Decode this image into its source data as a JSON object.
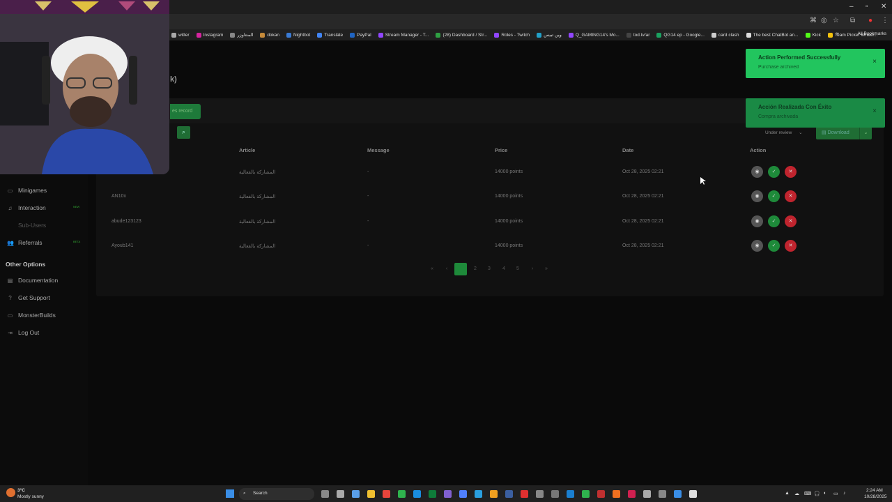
{
  "browser": {
    "bookmarks": [
      {
        "label": "witter",
        "color": "#aaaaaa"
      },
      {
        "label": "Instagram",
        "color": "#d6249f"
      },
      {
        "label": "المنتاوزر",
        "color": "#888888"
      },
      {
        "label": "dokan",
        "color": "#c58a3a"
      },
      {
        "label": "Nightbot",
        "color": "#3a7bd5"
      },
      {
        "label": "Translate",
        "color": "#4285f4"
      },
      {
        "label": "PayPal",
        "color": "#1f64c2"
      },
      {
        "label": "Stream Manager - T...",
        "color": "#9146ff"
      },
      {
        "label": "(28) Dashboard / Str...",
        "color": "#2ea043"
      },
      {
        "label": "Roles - Twitch",
        "color": "#9146ff"
      },
      {
        "label": "وين تبيس",
        "color": "#22a0c8"
      },
      {
        "label": "Q_GAMING14's Mo...",
        "color": "#9146ff"
      },
      {
        "label": "tod.tv/ar",
        "color": "#444444"
      },
      {
        "label": "QG14 ep - Google...",
        "color": "#1aa260"
      },
      {
        "label": "card clash",
        "color": "#cccccc"
      },
      {
        "label": "The best ChatBot an...",
        "color": "#dddddd"
      },
      {
        "label": "Kick",
        "color": "#53fc18"
      },
      {
        "label": "Team Picker Wheel...",
        "color": "#f4c20d"
      }
    ],
    "more_label": "»",
    "all_bookmarks": "All Bookmarks"
  },
  "sidebar": {
    "items": [
      {
        "label": "Minigames",
        "icon": "gamepad-icon",
        "glyph": "▭"
      },
      {
        "label": "Interaction",
        "icon": "music-icon",
        "glyph": "♫",
        "badge": "NEW"
      },
      {
        "label": "Sub-Users",
        "icon": "users-icon",
        "glyph": ""
      },
      {
        "label": "Referrals",
        "icon": "people-icon",
        "glyph": "👥",
        "badge": "BETA"
      }
    ],
    "other_heading": "Other Options",
    "other_items": [
      {
        "label": "Documentation",
        "icon": "book-icon",
        "glyph": "▤"
      },
      {
        "label": "Get Support",
        "icon": "help-icon",
        "glyph": "?"
      },
      {
        "label": "MonsterBuilds",
        "icon": "monitor-icon",
        "glyph": "▭"
      },
      {
        "label": "Log Out",
        "icon": "logout-icon",
        "glyph": "⇥"
      }
    ]
  },
  "main": {
    "heading_fragment": "k)",
    "archive_button_fragment": "es record",
    "filter_label": "Under review",
    "download_label": "Download",
    "columns": [
      "Article",
      "Message",
      "Price",
      "Date",
      "Action"
    ],
    "rows": [
      {
        "user": "",
        "article": "المشاركة بالفعالية",
        "message": "-",
        "price": "14000 points",
        "date": "Oct 28, 2025 02:21"
      },
      {
        "user": "AN10x",
        "article": "المشاركة بالفعالية",
        "message": "-",
        "price": "14000 points",
        "date": "Oct 28, 2025 02:21"
      },
      {
        "user": "abude123123",
        "article": "المشاركة بالفعالية",
        "message": "-",
        "price": "14000 points",
        "date": "Oct 28, 2025 02:21"
      },
      {
        "user": "Ayoub141",
        "article": "المشاركة بالفعالية",
        "message": "-",
        "price": "14000 points",
        "date": "Oct 28, 2025 02:21"
      }
    ],
    "pagination": [
      "«",
      "‹",
      "1",
      "2",
      "3",
      "4",
      "5",
      "›",
      "»"
    ],
    "active_page": "1"
  },
  "toasts": [
    {
      "title": "Action Performed Successfully",
      "body": "Purchase archived",
      "bg": "#22c55e",
      "fg": "#0b3d1c"
    },
    {
      "title": "Acción Realizada Con Éxito",
      "body": "Compra archivada",
      "bg": "#1a8a45",
      "fg": "#0d3b20"
    }
  ],
  "taskbar": {
    "weather_temp": "3°C",
    "weather_desc": "Mostly sunny",
    "search_label": "Search",
    "time": "2:24 AM",
    "date": "10/28/2025"
  },
  "colors": {
    "accent": "#1e8a3a",
    "danger": "#c0242e",
    "muted_btn": "#555555"
  }
}
